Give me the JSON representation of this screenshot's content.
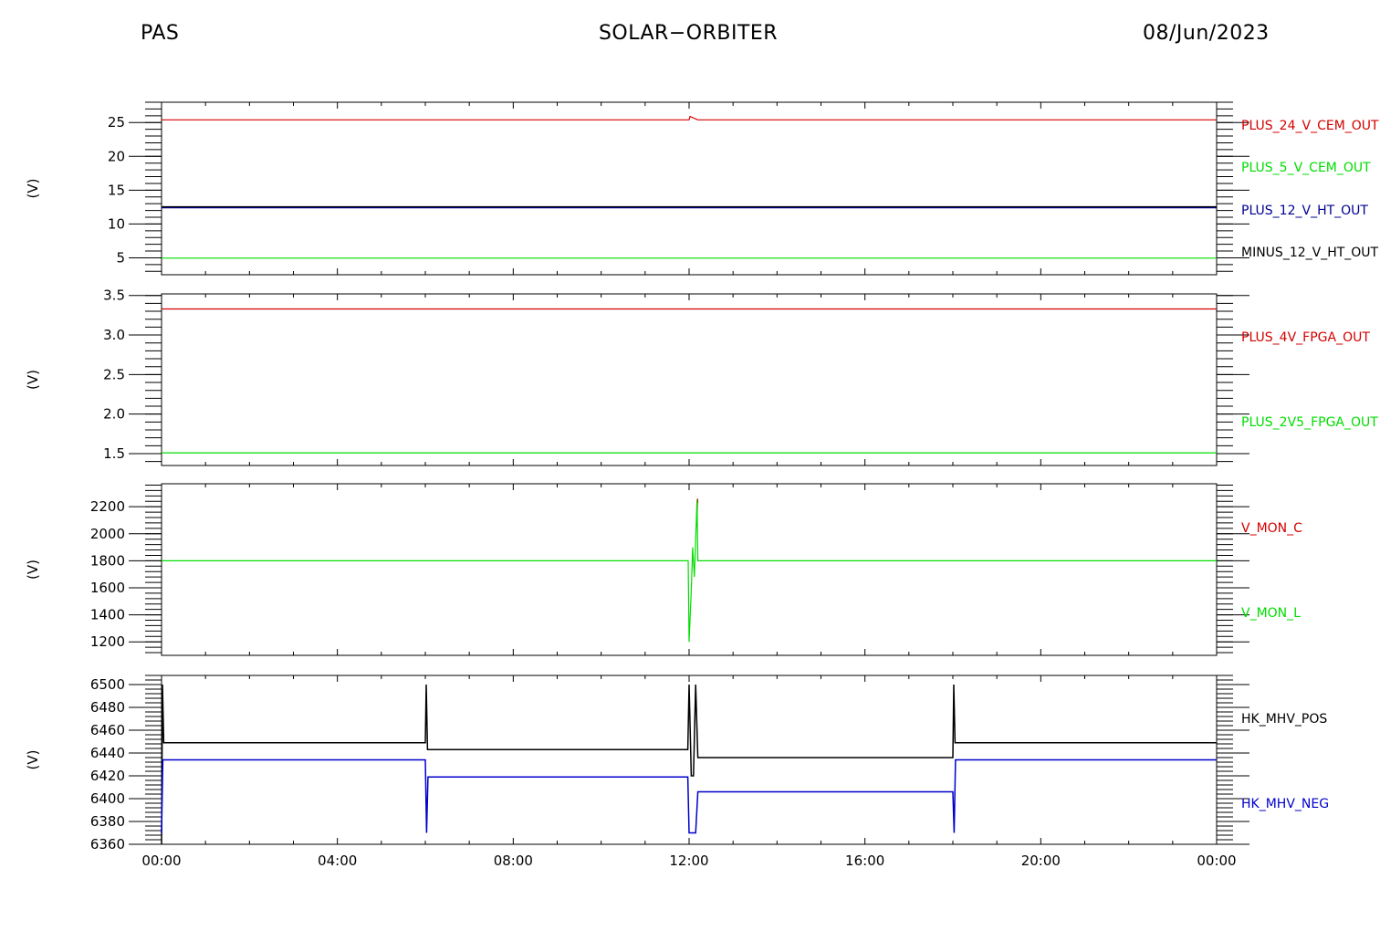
{
  "header": {
    "instrument": "PAS",
    "mission": "SOLAR−ORBITER",
    "date": "08/Jun/2023"
  },
  "chart_data": [
    {
      "type": "line",
      "ylabel": "(V)",
      "ylim": [
        2.5,
        28.0
      ],
      "yticks": [
        5,
        10,
        15,
        20,
        25
      ],
      "ytick_labels": [
        "5",
        "10",
        "15",
        "20",
        "25"
      ],
      "x_unit": "hours",
      "xlim": [
        0,
        24
      ],
      "series": [
        {
          "name": "PLUS_24_V_CEM_OUT",
          "color": "#d40000",
          "points": [
            [
              0,
              25.4
            ],
            [
              12.0,
              25.4
            ],
            [
              12.02,
              25.9
            ],
            [
              12.2,
              25.4
            ],
            [
              24,
              25.4
            ]
          ]
        },
        {
          "name": "PLUS_5_V_CEM_OUT",
          "color": "#00dd00",
          "points": [
            [
              0,
              4.95
            ],
            [
              24,
              4.95
            ]
          ]
        },
        {
          "name": "PLUS_12_V_HT_OUT",
          "color": "#000090",
          "points": [
            [
              0,
              12.4
            ],
            [
              24,
              12.4
            ]
          ]
        },
        {
          "name": "MINUS_12_V_HT_OUT",
          "color": "#000000",
          "points": [
            [
              0,
              12.55
            ],
            [
              24,
              12.55
            ]
          ]
        }
      ]
    },
    {
      "type": "line",
      "ylabel": "(V)",
      "ylim": [
        1.35,
        3.52
      ],
      "yticks": [
        1.5,
        2.0,
        2.5,
        3.0,
        3.5
      ],
      "ytick_labels": [
        "1.5",
        "2.0",
        "2.5",
        "3.0",
        "3.5"
      ],
      "x_unit": "hours",
      "xlim": [
        0,
        24
      ],
      "series": [
        {
          "name": "PLUS_4V_FPGA_OUT",
          "color": "#d40000",
          "points": [
            [
              0,
              3.33
            ],
            [
              24,
              3.33
            ]
          ]
        },
        {
          "name": "PLUS_2V5_FPGA_OUT",
          "color": "#00dd00",
          "points": [
            [
              0,
              1.51
            ],
            [
              24,
              1.51
            ]
          ]
        }
      ]
    },
    {
      "type": "line",
      "ylabel": "(V)",
      "ylim": [
        1100,
        2370
      ],
      "yticks": [
        1200,
        1400,
        1600,
        1800,
        2000,
        2200
      ],
      "ytick_labels": [
        "1200",
        "1400",
        "1600",
        "1800",
        "2000",
        "2200"
      ],
      "x_unit": "hours",
      "xlim": [
        0,
        24
      ],
      "series": [
        {
          "name": "V_MON_C",
          "color": "#d40000",
          "points": [
            [
              12.18,
              2050
            ],
            [
              12.19,
              2260
            ],
            [
              12.2,
              2230
            ]
          ]
        },
        {
          "name": "V_MON_L",
          "color": "#00dd00",
          "points": [
            [
              0,
              1800
            ],
            [
              11.98,
              1800
            ],
            [
              12.0,
              1200
            ],
            [
              12.05,
              1580
            ],
            [
              12.08,
              1900
            ],
            [
              12.12,
              1680
            ],
            [
              12.18,
              2250
            ],
            [
              12.2,
              1800
            ],
            [
              24,
              1800
            ]
          ]
        }
      ]
    },
    {
      "type": "line",
      "ylabel": "(V)",
      "ylim": [
        6360,
        6508
      ],
      "yticks": [
        6360,
        6380,
        6400,
        6420,
        6440,
        6460,
        6480,
        6500
      ],
      "ytick_labels": [
        "6360",
        "6380",
        "6400",
        "6420",
        "6440",
        "6460",
        "6480",
        "6500"
      ],
      "x_unit": "hours",
      "xlim": [
        0,
        24
      ],
      "series": [
        {
          "name": "HK_MHV_POS",
          "color": "#000000",
          "points": [
            [
              0,
              6360
            ],
            [
              0.02,
              6500
            ],
            [
              0.05,
              6449
            ],
            [
              6.0,
              6449
            ],
            [
              6.02,
              6500
            ],
            [
              6.05,
              6443
            ],
            [
              11.97,
              6443
            ],
            [
              12.0,
              6500
            ],
            [
              12.05,
              6420
            ],
            [
              12.1,
              6420
            ],
            [
              12.15,
              6500
            ],
            [
              12.2,
              6436
            ],
            [
              18.0,
              6436
            ],
            [
              18.02,
              6500
            ],
            [
              18.05,
              6449
            ],
            [
              24,
              6449
            ]
          ]
        },
        {
          "name": "HK_MHV_NEG",
          "color": "#0000cc",
          "points": [
            [
              0,
              6370
            ],
            [
              0.03,
              6434
            ],
            [
              6.0,
              6434
            ],
            [
              6.03,
              6370
            ],
            [
              6.06,
              6419
            ],
            [
              11.97,
              6419
            ],
            [
              12.0,
              6370
            ],
            [
              12.15,
              6370
            ],
            [
              12.2,
              6406
            ],
            [
              18.0,
              6406
            ],
            [
              18.03,
              6370
            ],
            [
              18.06,
              6434
            ],
            [
              24,
              6434
            ]
          ]
        }
      ]
    }
  ],
  "x_ticks": [
    0,
    4,
    8,
    12,
    16,
    20,
    24
  ],
  "x_tick_labels": [
    "00:00",
    "04:00",
    "08:00",
    "12:00",
    "16:00",
    "20:00",
    "00:00"
  ]
}
